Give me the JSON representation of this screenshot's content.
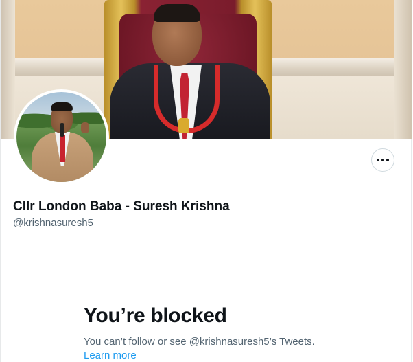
{
  "profile": {
    "display_name": "Cllr London Baba - Suresh Krishna",
    "handle": "@krishnasuresh5",
    "more_icon": "ellipsis-icon"
  },
  "blocked": {
    "title": "You’re blocked",
    "message": "You can’t follow or see @krishnasuresh5’s Tweets.",
    "learn_more": "Learn more"
  },
  "colors": {
    "text_primary": "#0f1419",
    "text_secondary": "#536471",
    "link": "#1d9bf0",
    "border": "#cfd9de"
  }
}
